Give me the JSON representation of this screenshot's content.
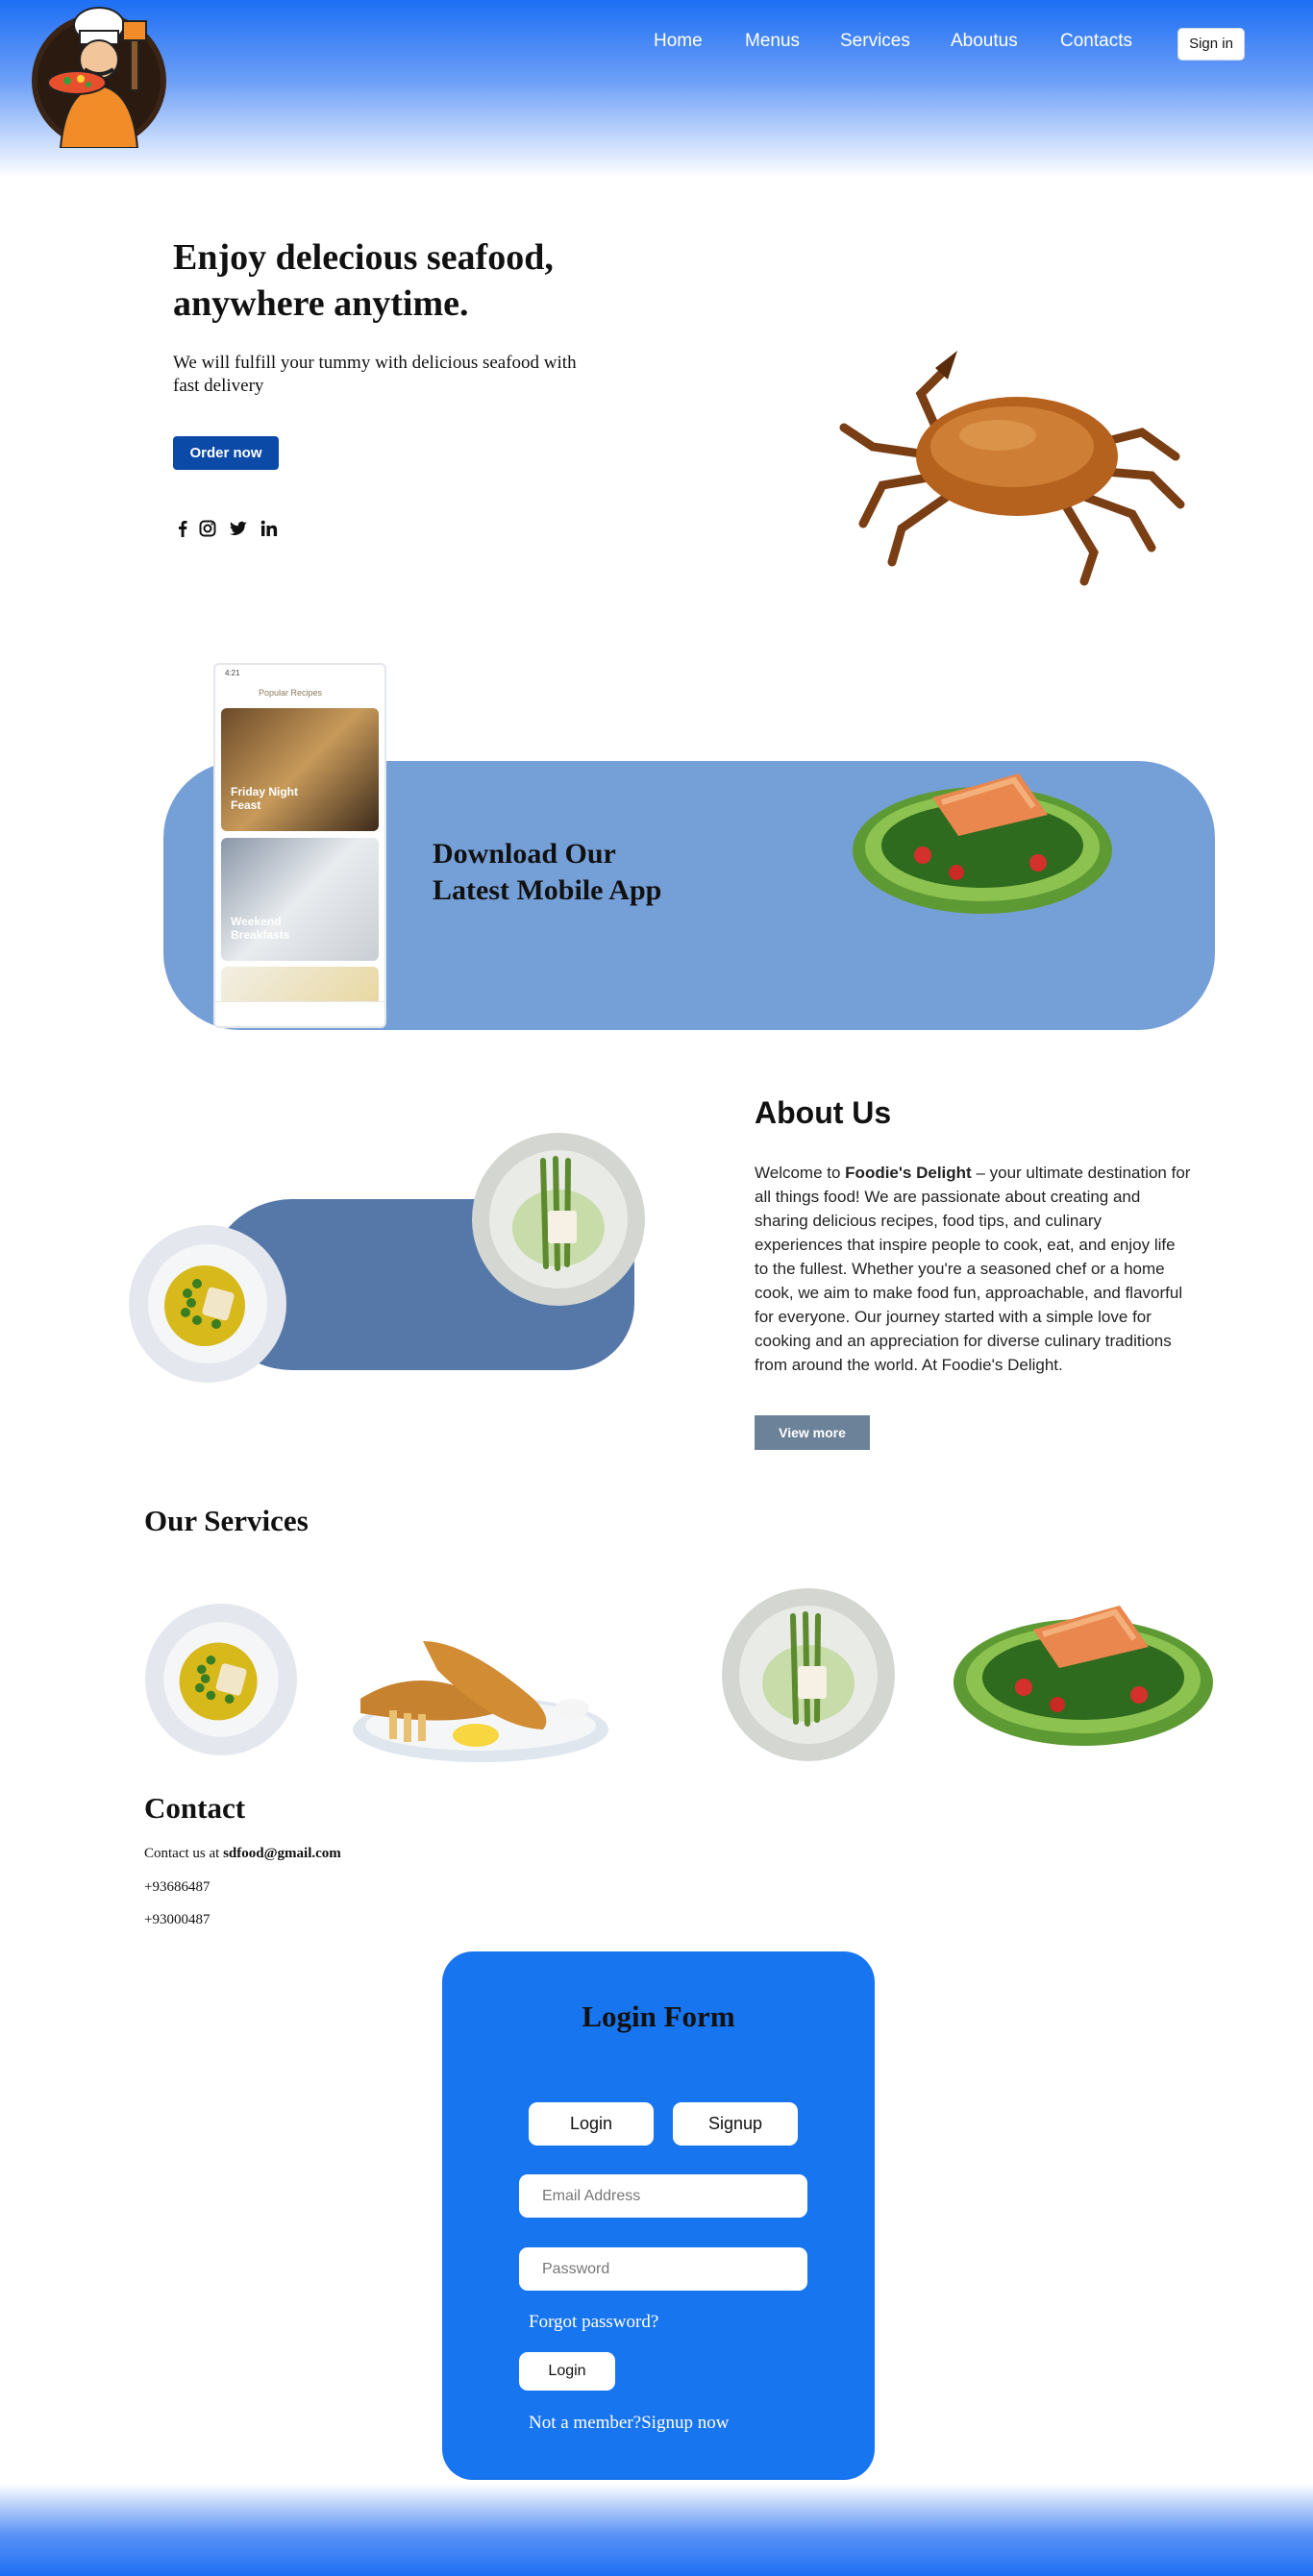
{
  "header": {
    "nav": [
      "Home",
      "Menus",
      "Services",
      "Aboutus",
      "Contacts"
    ],
    "signin_label": "Sign in"
  },
  "hero": {
    "title_line1": "Enjoy delecious seafood,",
    "title_line2": "anywhere anytime.",
    "subtitle": "We will fulfill your tummy with delicious seafood with fast delivery",
    "order_label": "Order now",
    "socials": [
      "facebook-icon",
      "instagram-icon",
      "twitter-icon",
      "linkedin-icon"
    ]
  },
  "app_banner": {
    "title_line1": "Download Our",
    "title_line2": "Latest Mobile App",
    "phone": {
      "time": "4:21",
      "header": "Popular Recipes",
      "card1": "Friday Night Feast",
      "card2": "Weekend Breakfasts"
    }
  },
  "about": {
    "title": "About Us",
    "text_prefix": "Welcome to ",
    "brand": "Foodie's Delight",
    "text_rest": " – your ultimate destination for all things food! We are passionate about creating and sharing delicious recipes, food tips, and culinary experiences that inspire people to cook, eat, and enjoy life to the fullest. Whether you're a seasoned chef or a home cook, we aim to make food fun, approachable, and flavorful for everyone. Our journey started with a simple love for cooking and an appreciation for diverse culinary traditions from around the world. At Foodie's Delight.",
    "button": "View more"
  },
  "services": {
    "title": "Our Services"
  },
  "contact": {
    "title": "Contact",
    "email_prefix": "Contact us at ",
    "email": "sdfood@gmail.com",
    "phone1": "+93686487",
    "phone2": "+93000487"
  },
  "login": {
    "title": "Login Form",
    "tab_login": "Login",
    "tab_signup": "Signup",
    "email_placeholder": "Email Address",
    "password_placeholder": "Password",
    "forgot": "Forgot password?",
    "submit": "Login",
    "signup_text": "Not a member?Signup now"
  },
  "colors": {
    "primary_blue": "#1875f0",
    "band_blue": "#759fd7",
    "about_band": "#5678a8",
    "order_button": "#0b4aa7",
    "view_more": "#6c8298"
  }
}
